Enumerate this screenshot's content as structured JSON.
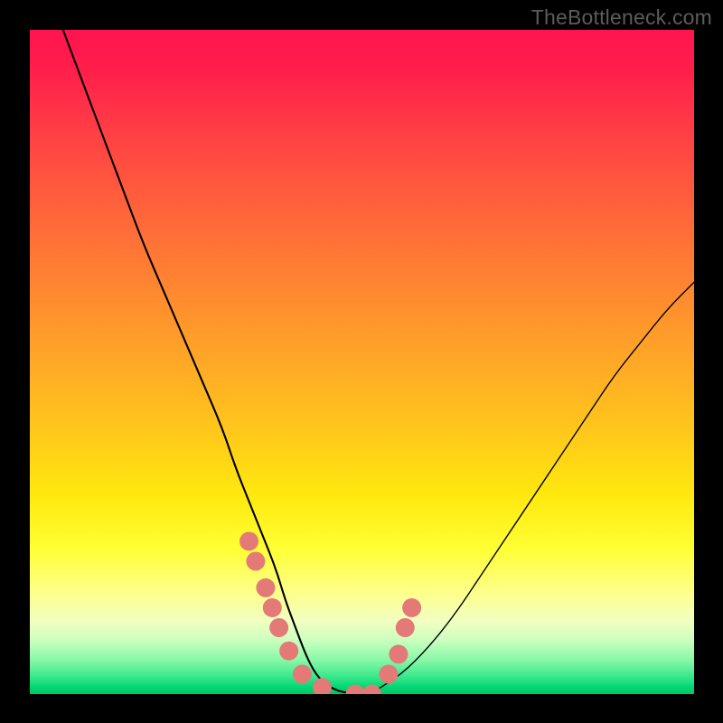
{
  "watermark": "TheBottleneck.com",
  "chart_data": {
    "type": "line",
    "title": "",
    "xlabel": "",
    "ylabel": "",
    "xlim": [
      0,
      100
    ],
    "ylim": [
      0,
      100
    ],
    "grid": false,
    "series": [
      {
        "name": "bottleneck-curve",
        "x": [
          5,
          8,
          11,
          14,
          17,
          20,
          23,
          26,
          29,
          31,
          33,
          35,
          37,
          38.5,
          40,
          41.5,
          43,
          45,
          48,
          52,
          56,
          60,
          64,
          68,
          72,
          76,
          80,
          84,
          88,
          92,
          96,
          100
        ],
        "y": [
          100,
          92,
          84,
          76,
          68,
          61,
          54,
          47,
          40,
          34,
          29,
          24,
          19,
          14,
          10,
          6,
          3,
          1,
          0,
          0.5,
          3,
          7,
          12,
          18,
          24,
          30,
          36,
          42,
          48,
          53,
          58,
          62
        ]
      }
    ],
    "markers": {
      "name": "highlight-dots",
      "color": "#e47a78",
      "points": [
        {
          "x": 33.0,
          "y": 23
        },
        {
          "x": 34.0,
          "y": 20
        },
        {
          "x": 35.5,
          "y": 16
        },
        {
          "x": 36.5,
          "y": 13
        },
        {
          "x": 37.5,
          "y": 10
        },
        {
          "x": 39.0,
          "y": 6.5
        },
        {
          "x": 41.0,
          "y": 3
        },
        {
          "x": 44.0,
          "y": 1
        },
        {
          "x": 49.0,
          "y": 0
        },
        {
          "x": 51.5,
          "y": 0
        },
        {
          "x": 54.0,
          "y": 3
        },
        {
          "x": 55.5,
          "y": 6
        },
        {
          "x": 56.5,
          "y": 10
        },
        {
          "x": 57.5,
          "y": 13
        }
      ]
    },
    "gradient_stops": [
      {
        "pos": 0,
        "color": "#ff1450"
      },
      {
        "pos": 50,
        "color": "#ffc61c"
      },
      {
        "pos": 80,
        "color": "#ffff33"
      },
      {
        "pos": 100,
        "color": "#00c763"
      }
    ]
  }
}
